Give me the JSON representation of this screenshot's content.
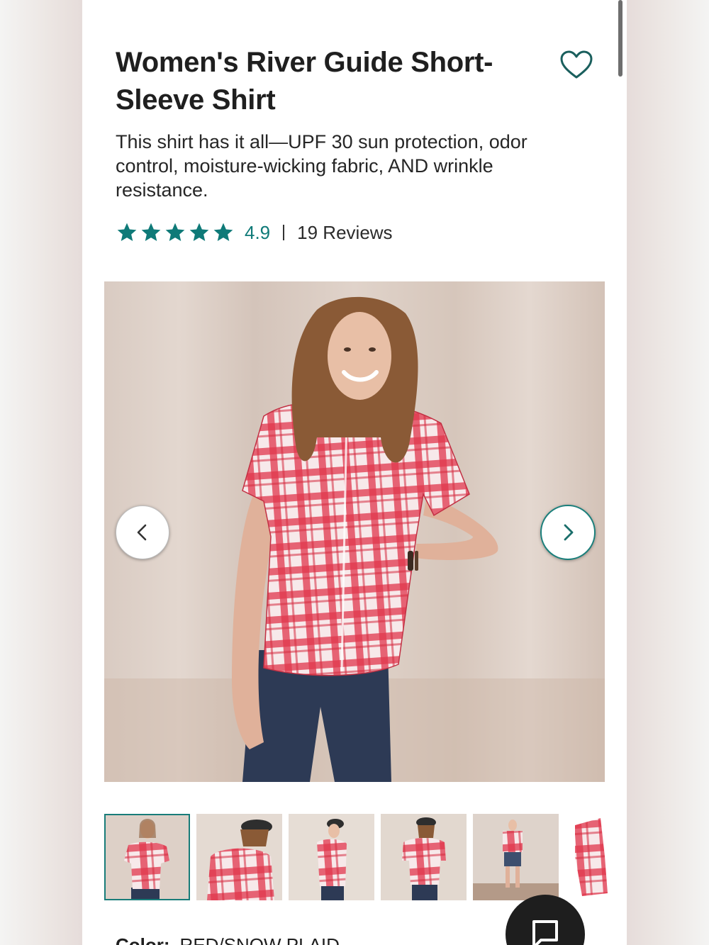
{
  "product": {
    "title": "Women's River Guide Short-Sleeve Shirt",
    "description": "This shirt has it all—UPF 30 sun protection, odor control, moisture-wicking fabric, AND wrinkle resistance.",
    "rating": {
      "stars": 5,
      "value": "4.9",
      "reviews_label": "19 Reviews"
    },
    "color": {
      "label": "Color:",
      "value": "RED/SNOW PLAID"
    }
  },
  "gallery": {
    "thumbnail_count": 6,
    "active_index": 0
  },
  "icons": {
    "favorite": "heart-outline-icon",
    "prev": "chevron-left-icon",
    "next": "chevron-right-icon",
    "chat": "chat-bubble-icon",
    "star": "star-icon"
  },
  "colors": {
    "accent": "#0f7a78",
    "text": "#1f1f1f",
    "plaid_red": "#e0374c"
  }
}
